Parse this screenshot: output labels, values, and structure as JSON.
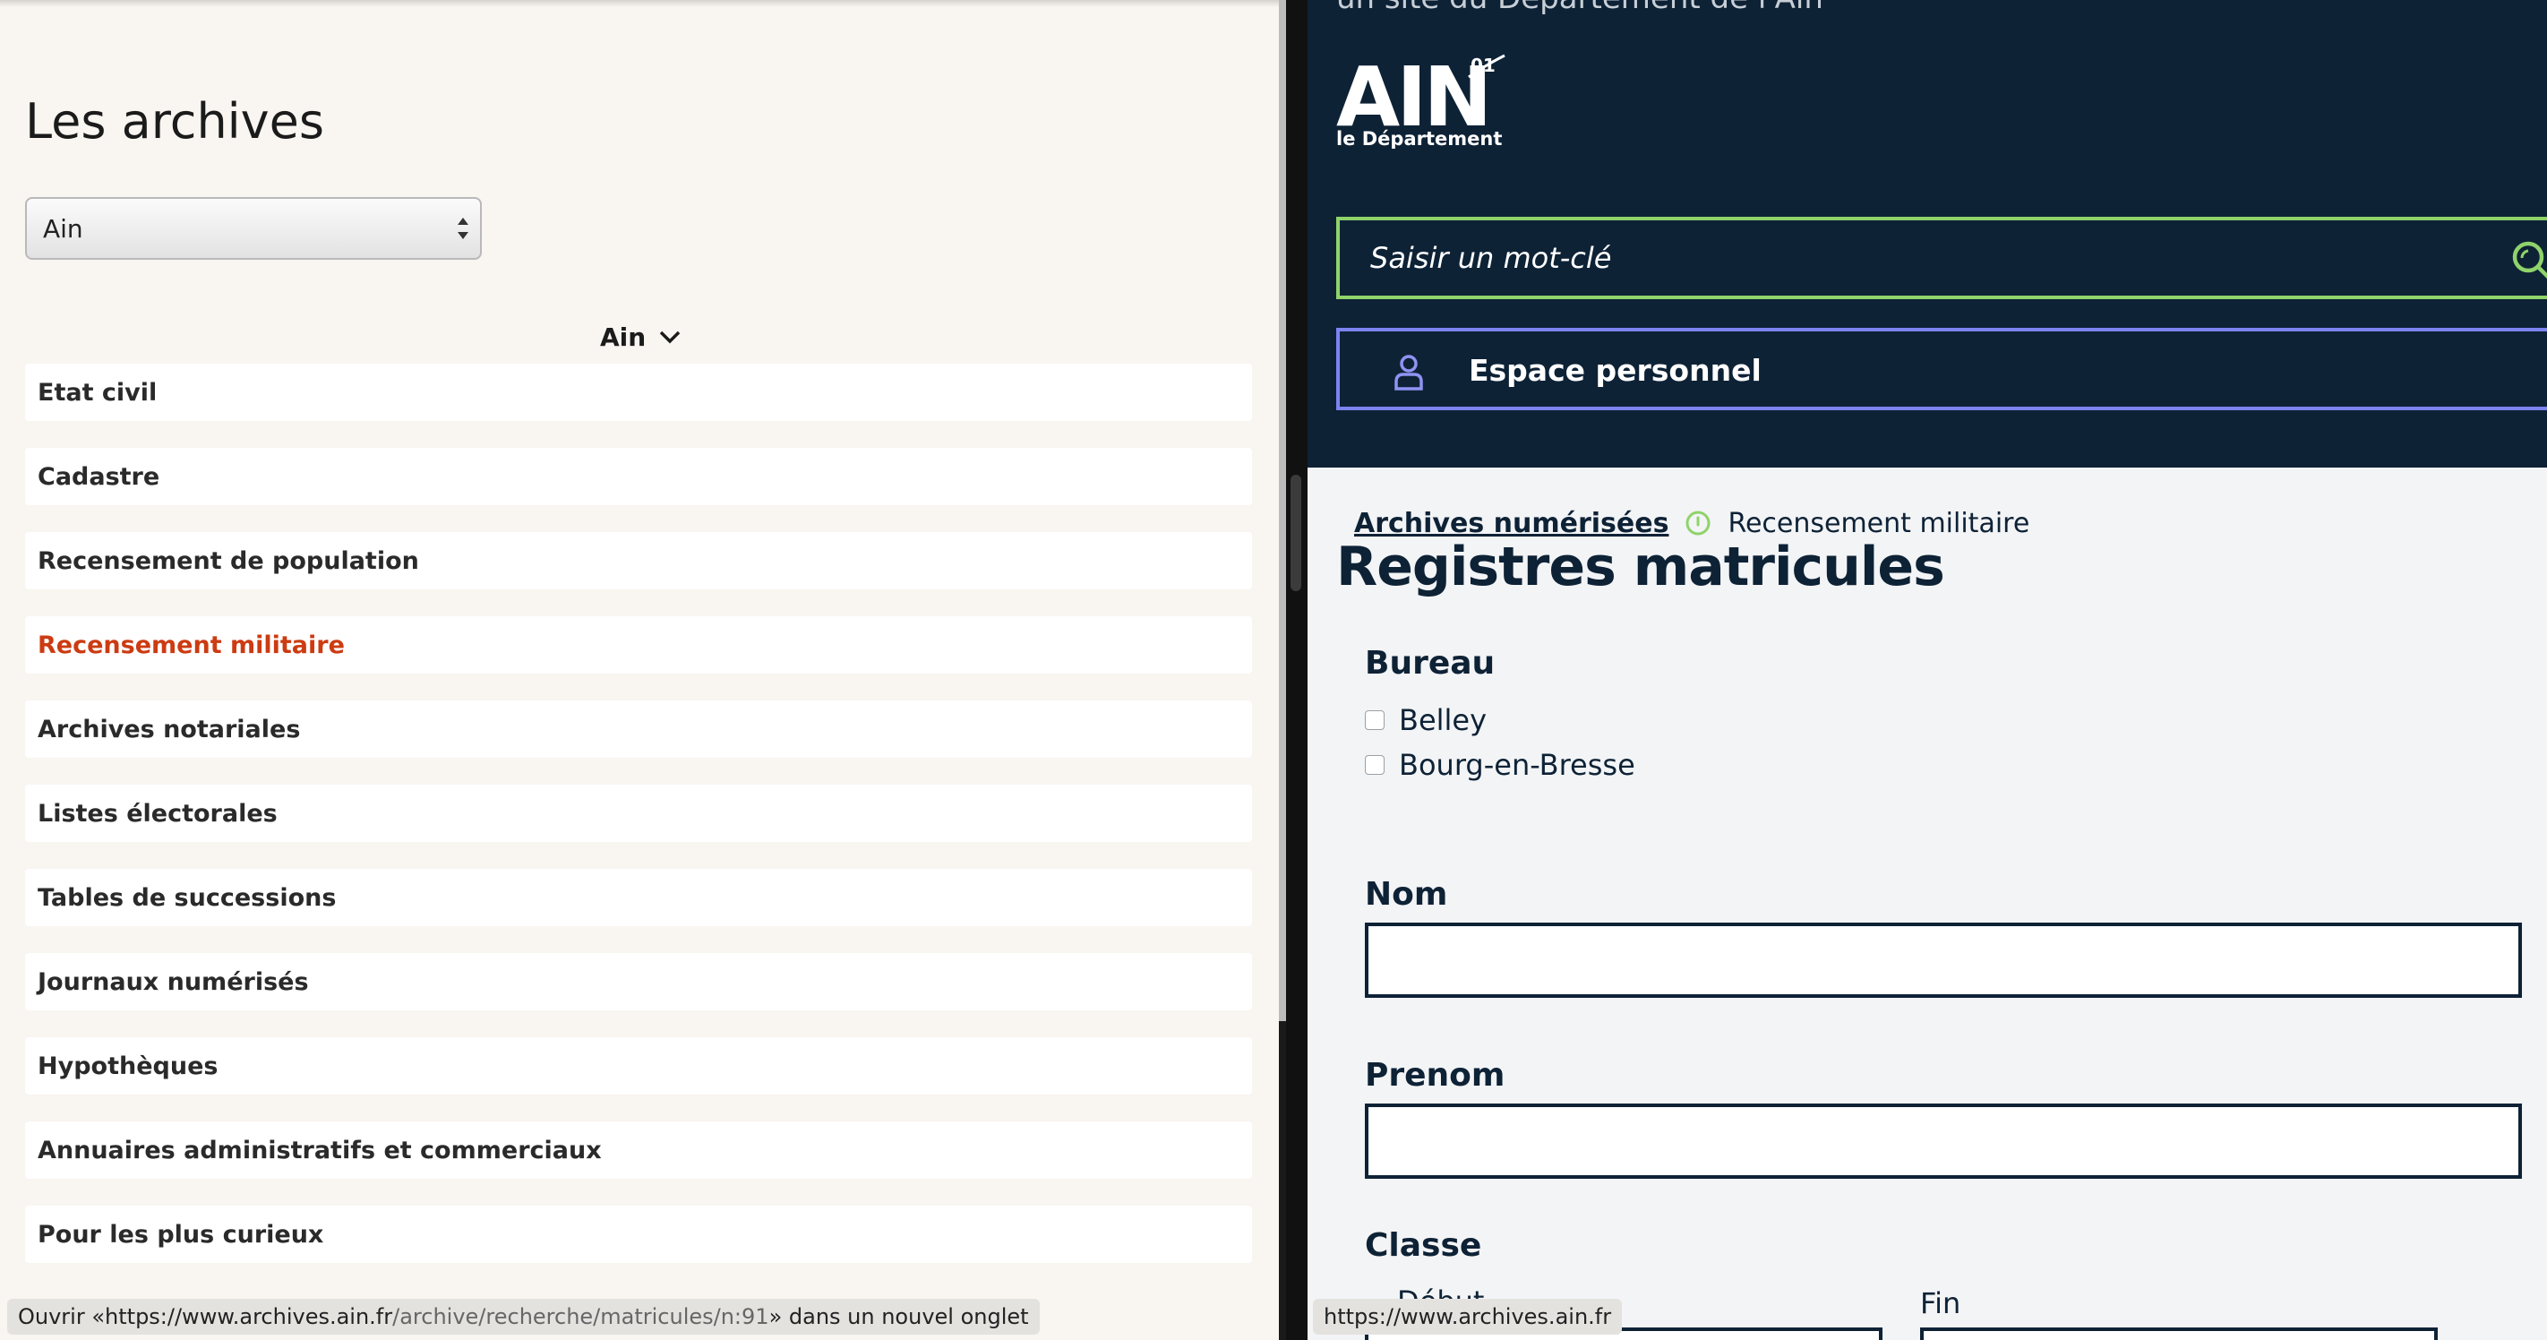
{
  "left": {
    "title": "Les archives",
    "select_value": "Ain",
    "dropdown_label": "Ain",
    "categories": [
      {
        "label": "Etat civil",
        "active": false
      },
      {
        "label": "Cadastre",
        "active": false
      },
      {
        "label": "Recensement de population",
        "active": false
      },
      {
        "label": "Recensement militaire",
        "active": true
      },
      {
        "label": "Archives notariales",
        "active": false
      },
      {
        "label": "Listes électorales",
        "active": false
      },
      {
        "label": "Tables de successions",
        "active": false
      },
      {
        "label": "Journaux numérisés",
        "active": false
      },
      {
        "label": "Hypothèques",
        "active": false
      },
      {
        "label": "Annuaires administratifs et commerciaux",
        "active": false
      },
      {
        "label": "Pour les plus curieux",
        "active": false
      }
    ],
    "status": {
      "prefix": "Ouvrir « ",
      "url_host": "https://www.archives.ain.fr",
      "url_path": "/archive/recherche/matricules/n:91",
      "suffix": " » dans un nouvel onglet"
    }
  },
  "right": {
    "tagline": "un site du Département de l'Ain",
    "logo": {
      "main": "AIN",
      "badge": "01",
      "sub": "le Département"
    },
    "search_placeholder": "Saisir un mot-clé",
    "personal_space": "Espace personnel",
    "breadcrumb": {
      "link": "Archives numérisées",
      "current": "Recensement militaire"
    },
    "page_title": "Registres matricules",
    "form": {
      "bureau_label": "Bureau",
      "bureau_options": [
        "Belley",
        "Bourg-en-Bresse"
      ],
      "nom_label": "Nom",
      "nom_value": "",
      "prenom_label": "Prenom",
      "prenom_value": "",
      "classe_label": "Classe",
      "classe_debut": "Début",
      "classe_fin": "Fin"
    },
    "status_url": "https://www.archives.ain.fr"
  },
  "colors": {
    "accent_active": "#cc3b12",
    "header_navy": "#0e2236",
    "search_border": "#8fd36a",
    "personal_border": "#7e83f0"
  },
  "icons": [
    "chevron-down-icon",
    "select-arrows-icon",
    "search-icon",
    "user-icon",
    "breadcrumb-separator-icon"
  ]
}
